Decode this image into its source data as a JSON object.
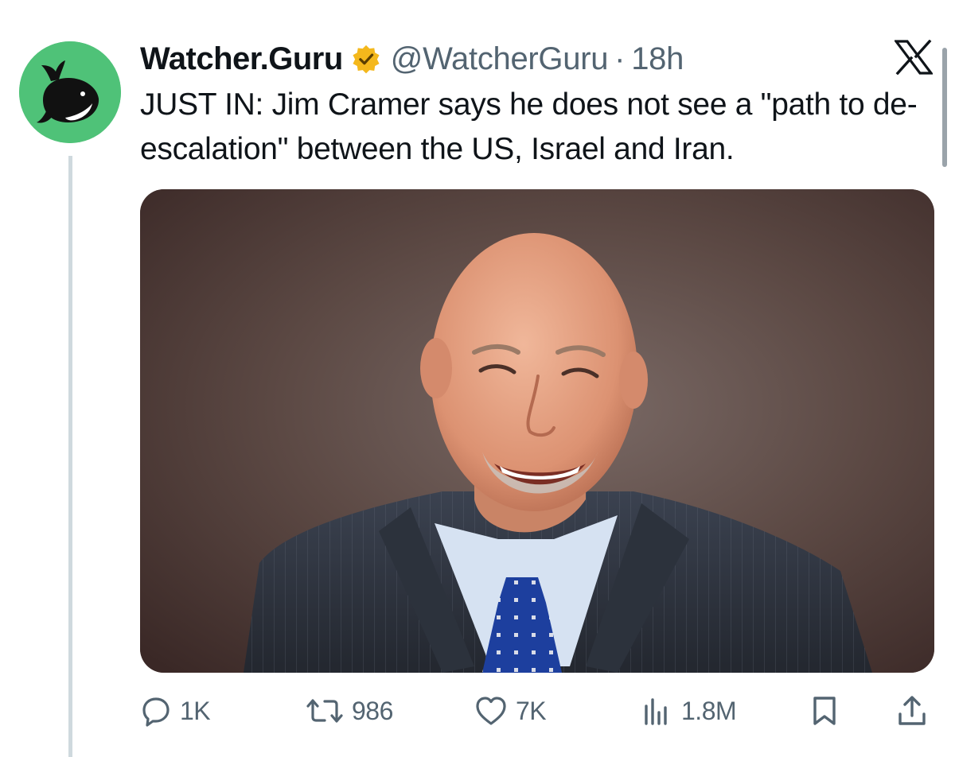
{
  "tweet": {
    "display_name": "Watcher.Guru",
    "handle": "@WatcherGuru",
    "separator": "·",
    "time": "18h",
    "text": "JUST IN: Jim Cramer says he does not see a \"path to de-escalation\" between the US, Israel and Iran.",
    "verified_badge_color": "#f4b81c",
    "avatar_color": "#4fc278",
    "avatar_icon": "whale-icon",
    "photo_subject": "man in pinstripe suit with blue polka-dot tie smiling"
  },
  "brand": {
    "logo": "x-logo-icon"
  },
  "actions": {
    "replies": "1K",
    "reposts": "986",
    "likes": "7K",
    "views": "1.8M",
    "icons": [
      "reply-icon",
      "repost-icon",
      "like-icon",
      "views-icon",
      "bookmark-icon",
      "share-icon"
    ]
  },
  "colors": {
    "text_primary": "#0f1419",
    "text_secondary": "#536471",
    "thread_line": "#cfd9de"
  }
}
